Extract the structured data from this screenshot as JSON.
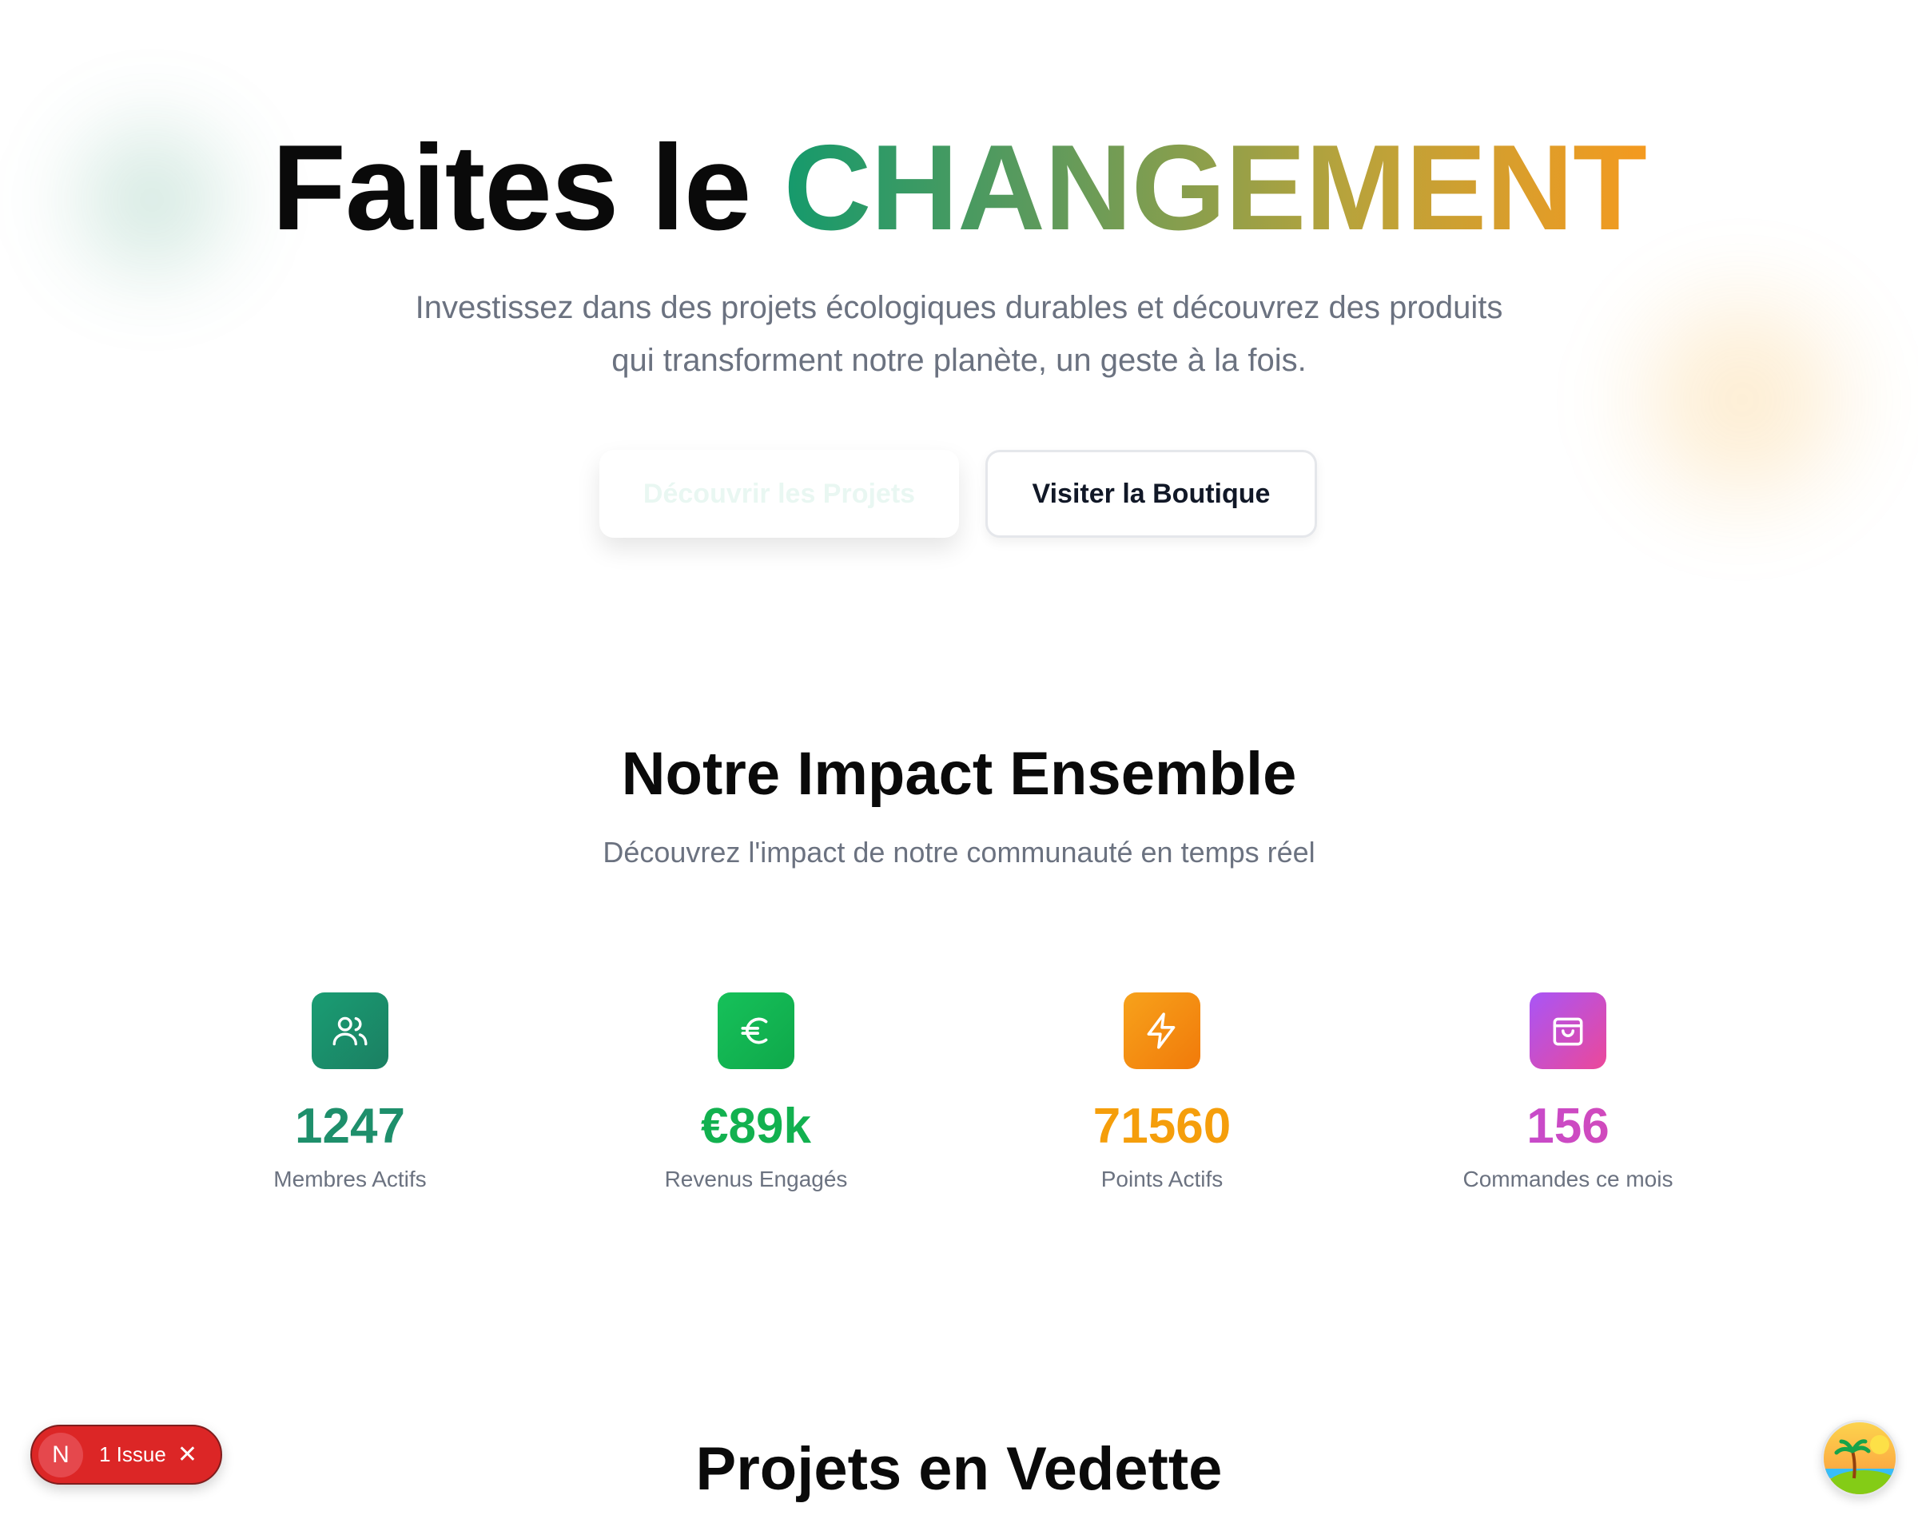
{
  "hero": {
    "title_prefix": "Faites le ",
    "title_highlight": "CHANGEMENT",
    "subtitle": "Investissez dans des projets écologiques durables et découvrez des produits qui transforment notre planète, un geste à la fois.",
    "primary_button": "Découvrir les Projets",
    "secondary_button": "Visiter la Boutique"
  },
  "impact": {
    "title": "Notre Impact Ensemble",
    "subtitle": "Découvrez l'impact de notre communauté en temps réel",
    "stats": [
      {
        "value": "1247",
        "label": "Membres Actifs",
        "icon": "users-icon",
        "color": "#1e8f6b"
      },
      {
        "value": "€89k",
        "label": "Revenus Engagés",
        "icon": "euro-icon",
        "color": "#12b14f"
      },
      {
        "value": "71560",
        "label": "Points Actifs",
        "icon": "zap-icon",
        "color": "#f59e0b"
      },
      {
        "value": "156",
        "label": "Commandes ce mois",
        "icon": "shopping-bag-icon",
        "color": "#c24ad8"
      }
    ]
  },
  "projects": {
    "title": "Projets en Vedette"
  },
  "dev_overlay": {
    "badge_letter": "N",
    "issue_label": "1 Issue",
    "close_glyph": "✕"
  },
  "colors": {
    "gradient_start": "#159a6c",
    "gradient_end": "#f49a1f",
    "issue_red": "#dc2626",
    "text_muted": "#6b7280"
  }
}
